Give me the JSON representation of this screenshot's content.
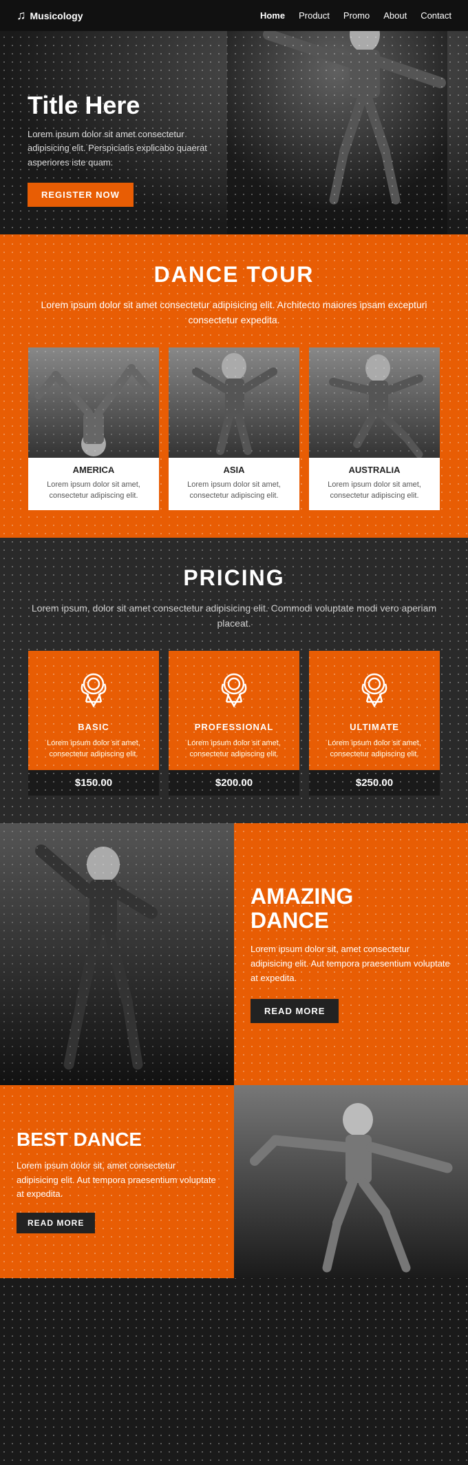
{
  "nav": {
    "logo_text": "Musicology",
    "links": [
      {
        "label": "Home",
        "active": true
      },
      {
        "label": "Product",
        "active": false
      },
      {
        "label": "Promo",
        "active": false
      },
      {
        "label": "About",
        "active": false
      },
      {
        "label": "Contact",
        "active": false
      }
    ]
  },
  "hero": {
    "title": "Title Here",
    "description": "Lorem ipsum dolor sit amet consectetur adipisicing elit. Perspiciatis explicabo quaerat asperiores iste quam.",
    "cta_label": "REGISTER NOW"
  },
  "dance_tour": {
    "section_title": "DANCE TOUR",
    "section_desc": "Lorem ipsum dolor sit amet consectetur adipisicing elit.\nArchitecto maiores ipsam excepturi consectetur expedita.",
    "cards": [
      {
        "name": "AMERICA",
        "text": "Lorem ipsum dolor sit amet, consectetur adipiscing elit."
      },
      {
        "name": "ASIA",
        "text": "Lorem ipsum dolor sit amet, consectetur adipiscing elit."
      },
      {
        "name": "AUSTRALIA",
        "text": "Lorem ipsum dolor sit amet, consectetur adipiscing elit."
      }
    ]
  },
  "pricing": {
    "section_title": "PRICING",
    "section_desc": "Lorem ipsum, dolor sit amet consectetur adipisicing elit.\nCommodi voluptate modi vero aperiam placeat.",
    "cards": [
      {
        "name": "BASIC",
        "text": "Lorem ipsum dolor sit amet, consectetur adipiscing elit.",
        "price": "$150.00"
      },
      {
        "name": "PROFESSIONAL",
        "text": "Lorem ipsum dolor sit amet, consectetur adipiscing elit.",
        "price": "$200.00"
      },
      {
        "name": "ULTIMATE",
        "text": "Lorem ipsum dolor sit amet, consectetur adipiscing elit.",
        "price": "$250.00"
      }
    ]
  },
  "amazing_dance": {
    "title": "AMAZING\nDANCE",
    "description": "Lorem ipsum dolor sit, amet consectetur adipisicing elit. Aut tempora praesentium voluptate at expedita.",
    "cta_label": "READ MORE"
  },
  "best_dance": {
    "title": "BEST DANCE",
    "description": "Lorem ipsum dolor sit, amet consectetur adipisicing elit. Aut tempora praesentium voluptate at expedita.",
    "cta_label": "READ MorE"
  },
  "colors": {
    "orange": "#e85d04",
    "dark": "#1a1a1a",
    "medium_dark": "#2a2a2a"
  }
}
